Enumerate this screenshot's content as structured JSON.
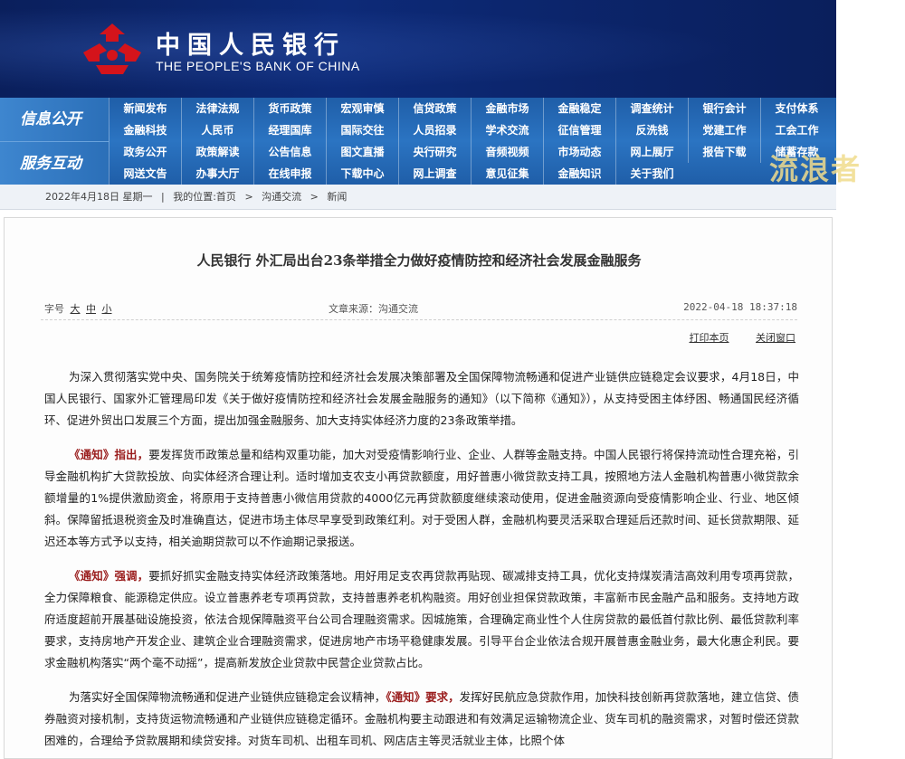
{
  "header": {
    "bank_name_cn": "中国人民银行",
    "bank_name_en": "THE PEOPLE'S BANK OF CHINA",
    "logo_icon": "pboc-logo-icon",
    "colors": {
      "banner": "#0d2a78",
      "nav": "#2b74c2",
      "logo_red": "#d4141b"
    }
  },
  "nav": {
    "section1": "信息公开",
    "section2": "服务互动",
    "rows": [
      [
        "新闻发布",
        "法律法规",
        "货币政策",
        "宏观审慎",
        "信贷政策",
        "金融市场",
        "金融稳定",
        "调查统计",
        "银行会计",
        "支付体系"
      ],
      [
        "金融科技",
        "人民币",
        "经理国库",
        "国际交往",
        "人员招录",
        "学术交流",
        "征信管理",
        "反洗钱",
        "党建工作",
        "工会工作"
      ],
      [
        "政务公开",
        "政策解读",
        "公告信息",
        "图文直播",
        "央行研究",
        "音频视频",
        "市场动态",
        "网上展厅",
        "报告下载",
        "储蓄存款"
      ],
      [
        "网送文告",
        "办事大厅",
        "在线申报",
        "下载中心",
        "网上调查",
        "意见征集",
        "金融知识",
        "关于我们"
      ]
    ]
  },
  "breadcrumb": {
    "date": "2022年4月18日 星期一",
    "sep": "|",
    "location_label": "我的位置:首页",
    "arrow": ">",
    "level1": "沟通交流",
    "level2": "新闻"
  },
  "watermark": "流浪者",
  "article": {
    "title": "人民银行 外汇局出台23条举措全力做好疫情防控和经济社会发展金融服务",
    "font_label": "字号",
    "font_large": "大",
    "font_mid": "中",
    "font_small": "小",
    "source": "文章来源：沟通交流",
    "date": "2022-04-18 18:37:18",
    "print": "打印本页",
    "close": "关闭窗口",
    "p1": "为深入贯彻落实党中央、国务院关于统筹疫情防控和经济社会发展决策部署及全国保障物流畅通和促进产业链供应链稳定会议要求，4月18日，中国人民银行、国家外汇管理局印发《关于做好疫情防控和经济社会发展金融服务的通知》（以下简称《通知》），从支持受困主体纾困、畅通国民经济循环、促进外贸出口发展三个方面，提出加强金融服务、加大支持实体经济力度的23条政策举措。",
    "p2_hl": "《通知》指出，",
    "p2": "要发挥货币政策总量和结构双重功能，加大对受疫情影响行业、企业、人群等金融支持。中国人民银行将保持流动性合理充裕，引导金融机构扩大贷款投放、向实体经济合理让利。适时增加支农支小再贷款额度，用好普惠小微贷款支持工具，按照地方法人金融机构普惠小微贷款余额增量的1%提供激励资金，将原用于支持普惠小微信用贷款的4000亿元再贷款额度继续滚动使用，促进金融资源向受疫情影响企业、行业、地区倾斜。保障留抵退税资金及时准确直达，促进市场主体尽早享受到政策红利。对于受困人群，金融机构要灵活采取合理延后还款时间、延长贷款期限、延迟还本等方式予以支持，相关逾期贷款可以不作逾期记录报送。",
    "p3_hl": "《通知》强调，",
    "p3": "要抓好抓实金融支持实体经济政策落地。用好用足支农再贷款再贴现、碳减排支持工具，优化支持煤炭清洁高效利用专项再贷款，全力保障粮食、能源稳定供应。设立普惠养老专项再贷款，支持普惠养老机构融资。用好创业担保贷款政策，丰富新市民金融产品和服务。支持地方政府适度超前开展基础设施投资，依法合规保障融资平台公司合理融资需求。因城施策，合理确定商业性个人住房贷款的最低首付款比例、最低贷款利率要求，支持房地产开发企业、建筑企业合理融资需求，促进房地产市场平稳健康发展。引导平台企业依法合规开展普惠金融业务，最大化惠企利民。要求金融机构落实“两个毫不动摇”，提高新发放企业贷款中民营企业贷款占比。",
    "p4_a": "为落实好全国保障物流畅通和促进产业链供应链稳定会议精神，",
    "p4_hl": "《通知》要求，",
    "p4": "发挥好民航应急贷款作用，加快科技创新再贷款落地，建立信贷、债券融资对接机制，支持货运物流畅通和产业链供应链稳定循环。金融机构要主动跟进和有效满足运输物流企业、货车司机的融资需求，对暂时偿还贷款困难的，合理给予贷款展期和续贷安排。对货车司机、出租车司机、网店店主等灵活就业主体，比照个体"
  }
}
